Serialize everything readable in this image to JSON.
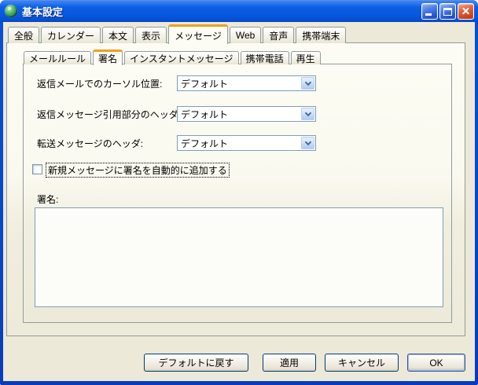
{
  "window": {
    "title": "基本設定"
  },
  "icons": {
    "app": "green-orb-app-icon",
    "minimize": "minimize-dash",
    "maximize": "maximize-square",
    "close": "close-x",
    "combo_arrow": "chevron-down"
  },
  "tabs_primary": {
    "selected": "メッセージ",
    "items": [
      "全般",
      "カレンダー",
      "本文",
      "表示",
      "メッセージ",
      "Web",
      "音声",
      "携帯端末"
    ]
  },
  "tabs_secondary": {
    "selected": "署名",
    "items": [
      "メールルール",
      "署名",
      "インスタントメッセージ",
      "携帯電話",
      "再生"
    ]
  },
  "form": {
    "rows": [
      {
        "label": "返信メールでのカーソル位置:",
        "value": "デフォルト"
      },
      {
        "label": "返信メッセージ引用部分のヘッダ:",
        "value": "デフォルト"
      },
      {
        "label": "転送メッセージのヘッダ:",
        "value": "デフォルト"
      }
    ],
    "checkbox": {
      "label": "新規メッセージに署名を自動的に追加する",
      "checked": false
    },
    "signature": {
      "label": "署名:",
      "value": ""
    }
  },
  "footer": {
    "restore_defaults_label": "デフォルトに戻す",
    "apply_label": "適用",
    "cancel_label": "キャンセル",
    "ok_label": "OK"
  },
  "colors": {
    "titlebar_blue": "#0659E0",
    "window_border": "#0846CE",
    "dialog_face": "#ECE9D8",
    "tab_accent_orange": "#EF9F1F",
    "panel_border": "#919B9C",
    "field_border": "#7F9DB9",
    "default_button_ring": "#9FBCE8"
  }
}
